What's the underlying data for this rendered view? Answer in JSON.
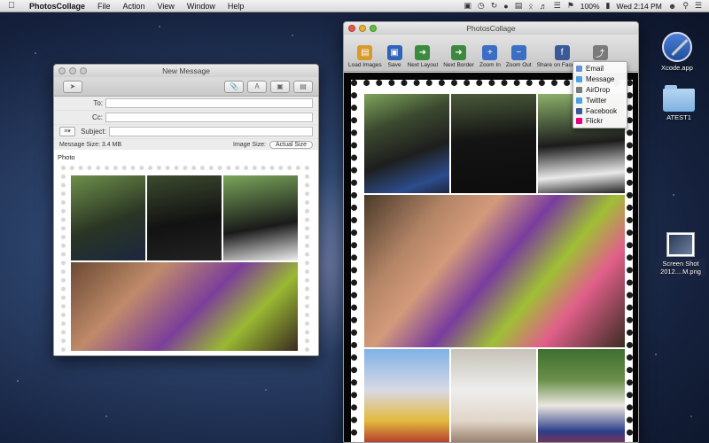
{
  "menubar": {
    "app": "PhotosCollage",
    "items": [
      "File",
      "Action",
      "View",
      "Window",
      "Help"
    ],
    "battery": "100%",
    "clock": "Wed 2:14 PM"
  },
  "mail": {
    "title": "New Message",
    "to_label": "To:",
    "cc_label": "Cc:",
    "subject_label": "Subject:",
    "message_size": "Message Size:  3.4 MB",
    "image_size_label": "Image Size:",
    "image_size_value": "Actual Size",
    "photo_label": "Photo"
  },
  "collage": {
    "title": "PhotosCollage",
    "tools": [
      {
        "label": "Load Images",
        "icon": "load-images-icon",
        "color": "#d79a2b"
      },
      {
        "label": "Save",
        "icon": "save-icon",
        "color": "#2e63b8"
      },
      {
        "label": "Next Layout",
        "icon": "next-layout-icon",
        "color": "#3c8a3e"
      },
      {
        "label": "Next Border",
        "icon": "next-border-icon",
        "color": "#3c8a3e"
      },
      {
        "label": "Zoom In",
        "icon": "zoom-in-icon",
        "color": "#3b6fc4"
      },
      {
        "label": "Zoom Out",
        "icon": "zoom-out-icon",
        "color": "#3b6fc4"
      },
      {
        "label": "Share on Facebook",
        "icon": "facebook-icon",
        "color": "#3b5998"
      },
      {
        "label": "Share",
        "icon": "share-icon",
        "color": "#7a7a7a"
      }
    ]
  },
  "share_menu": {
    "items": [
      {
        "label": "Email",
        "color": "#6a8fcf"
      },
      {
        "label": "Message",
        "color": "#4aa3df"
      },
      {
        "label": "AirDrop",
        "color": "#7a7a7a"
      },
      {
        "label": "Twitter",
        "color": "#4aa3df"
      },
      {
        "label": "Facebook",
        "color": "#3b5998"
      },
      {
        "label": "Flickr",
        "color": "#e5007e"
      }
    ]
  },
  "desktop": {
    "icons": [
      {
        "label": "Xcode.app"
      },
      {
        "label": "ATEST1"
      },
      {
        "label": "Screen Shot 2012....M.png"
      }
    ]
  }
}
